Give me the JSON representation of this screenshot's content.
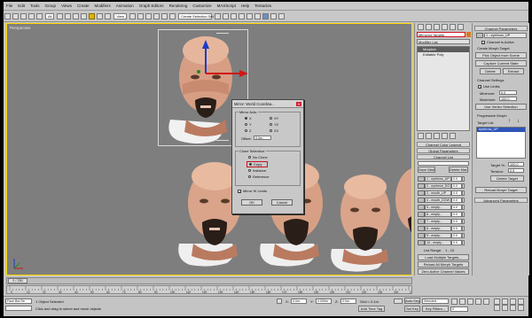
{
  "menubar": {
    "items": [
      "File",
      "Edit",
      "Tools",
      "Group",
      "Views",
      "Create",
      "Modifiers",
      "Animation",
      "Graph Editors",
      "Rendering",
      "Customize",
      "MAXScript",
      "Help",
      "Tentacles"
    ]
  },
  "toolbar": {
    "selection_set": "Create Selection Set",
    "view_combo": "View"
  },
  "viewport": {
    "label": "Perspective",
    "accent_color": "#ffd700"
  },
  "dialog": {
    "title": "Mirror: World Coordina...",
    "close_label": "X",
    "mirror_axis": {
      "label": "Mirror Axis:",
      "axes": [
        "X",
        "Y",
        "Z",
        "XY",
        "YZ",
        "ZX"
      ],
      "selected": "X",
      "offset_label": "Offset:",
      "offset_value": "0.0m"
    },
    "clone_selection": {
      "label": "Clone Selection:",
      "options": [
        "No Clone",
        "Copy",
        "Instance",
        "Reference"
      ],
      "selected": "Copy"
    },
    "mirror_ik": "Mirror IK Limits",
    "ok_label": "OK",
    "cancel_label": "Cancel"
  },
  "command_panel": {
    "object_name": "Mirrored Targets",
    "modifier_list": "Modifier List",
    "stack": [
      "Morpher",
      "Editable Poly"
    ],
    "channel_color_legend": "Channel Color Legend",
    "global_parameters": "Global Parameters",
    "channel_list": "Channel List",
    "mark_label": "Load Multiple Targets...",
    "channels": [
      {
        "name": "1 - eyebrow_UP",
        "value": "0.0"
      },
      {
        "name": "2 - eyebrow_DO",
        "value": "0.0"
      },
      {
        "name": "3 - mouth_UP",
        "value": "0.0"
      },
      {
        "name": "4 - mouth_DOW",
        "value": "0.0"
      },
      {
        "name": "5 - empty -",
        "value": "0.0"
      },
      {
        "name": "6 - empty -",
        "value": "0.0"
      },
      {
        "name": "7 - empty -",
        "value": "0.0"
      },
      {
        "name": "8 - empty -",
        "value": "0.0"
      },
      {
        "name": "9 - empty -",
        "value": "0.0"
      },
      {
        "name": "10 - empty -",
        "value": "0.0"
      }
    ],
    "list_range_label": "List Range:",
    "list_range_value": "1 - 10",
    "load_multiple": "Load Multiple Targets...",
    "reload_all": "Reload All Morph Targets",
    "zero_active": "Zero Active Channel Values",
    "auto_reload": "Automatically reload targets"
  },
  "right_panel": {
    "channel_parameters": "Channel Parameters",
    "channel_name": "1 - eyebrow_UP",
    "channel_active": "Channel is Active",
    "create_morph_target": "Create Morph Target",
    "pick_object": "Pick Object from Scene",
    "capture_current": "Capture Current State",
    "delete_label": "Delete",
    "extract_label": "Extract",
    "channel_settings": "Channel Settings",
    "use_limits": "Use Limits",
    "minimum_label": "Minimum:",
    "minimum_value": "0.0",
    "maximum_label": "Maximum:",
    "maximum_value": "100.0",
    "use_vertex_selection": "Use Vertex Selection",
    "progressive_morph": "Progressive Morph",
    "target_list": "Target List",
    "target_item": "eyebrow_UP",
    "target_pct_label": "Target %:",
    "target_pct_value": "100.0",
    "tension_label": "Tension:",
    "tension_value": "0.5",
    "delete_target": "Delete Target",
    "reload_morph_target": "Reload Morph Target",
    "advanced_parameters": "Advanced Parameters"
  },
  "timeline": {
    "frame_display": "0 / 250",
    "ticks": [
      "0",
      "10",
      "20",
      "30",
      "40",
      "50",
      "60",
      "70",
      "80",
      "90",
      "100",
      "110",
      "120",
      "130",
      "140",
      "150",
      "160",
      "170",
      "180",
      "190",
      "200",
      "210",
      "220",
      "230",
      "240",
      "250"
    ]
  },
  "status": {
    "script_box": "Face Bot Re",
    "objects_selected": "1 Object Selected",
    "hint": "Click and drag to select and move objects",
    "x_label": "X:",
    "x_value": "0.0m",
    "y_label": "Y:",
    "y_value": "0.009m",
    "z_label": "Z:",
    "z_value": "0.0m",
    "grid_label": "Grid = 0.1m",
    "add_time_tag": "Add Time Tag",
    "auto_key": "Auto Key",
    "set_key": "Set Key",
    "selected_label": "Selected",
    "key_filters": "Key Filters...",
    "frame_value": "0"
  },
  "colors": {
    "ui_gray": "#c4c4c4",
    "viewport": "#7e7e7e",
    "highlight_red": "#cc1122",
    "selection_yellow": "#ffd700"
  }
}
